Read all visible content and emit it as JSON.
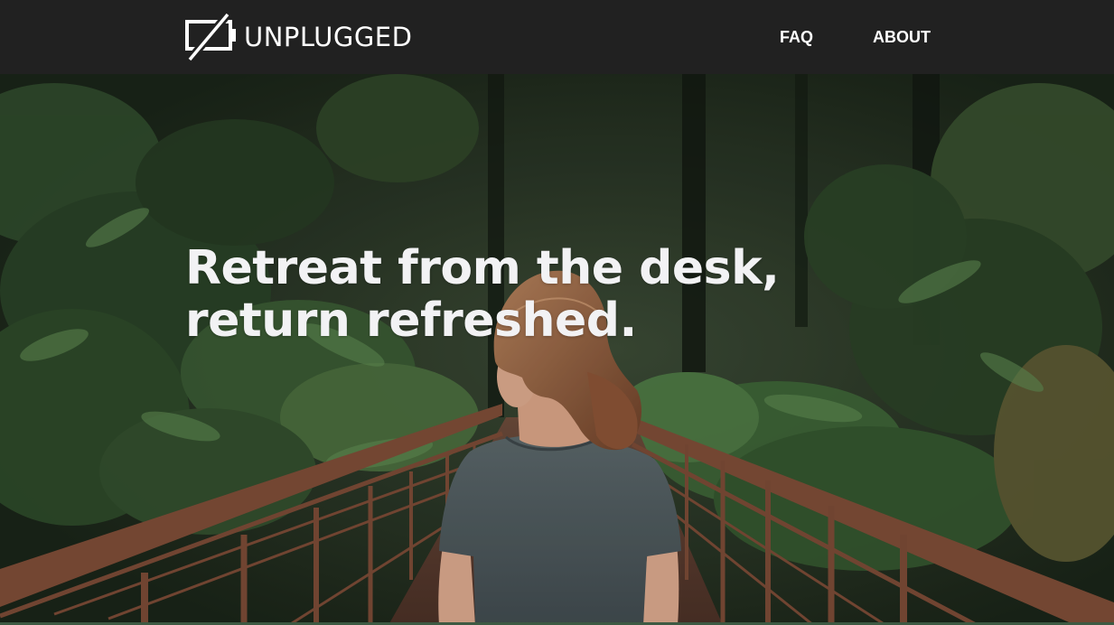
{
  "header": {
    "logo_text": "UNPLUGGED",
    "logo_icon": "unplugged-battery-icon",
    "nav": {
      "faq": "FAQ",
      "about": "ABOUT"
    }
  },
  "hero": {
    "headline_line1": "Retreat from the desk,",
    "headline_line2": "return refreshed.",
    "image": "woman-on-forest-bridge-photo"
  },
  "colors": {
    "header_bg": "#212121",
    "text": "#ffffff",
    "forest": "#24331f",
    "railing": "#7a4a36"
  }
}
